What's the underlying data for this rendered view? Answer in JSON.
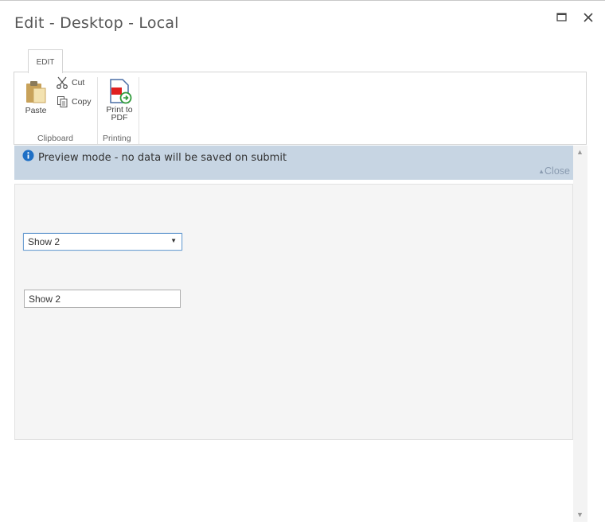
{
  "window": {
    "title": "Edit - Desktop - Local"
  },
  "ribbon": {
    "tab_label": "EDIT",
    "clipboard": {
      "group_label": "Clipboard",
      "paste_label": "Paste",
      "cut_label": "Cut",
      "copy_label": "Copy"
    },
    "printing": {
      "group_label": "Printing",
      "print_label_line1": "Print to",
      "print_label_line2": "PDF"
    }
  },
  "notice": {
    "message": "Preview mode - no data will be saved on submit",
    "close_label": "Close"
  },
  "form": {
    "dropdown_value": "Show 2",
    "text_value": "Show 2"
  },
  "colors": {
    "notice_bg": "#c7d5e3",
    "info_icon": "#1e6fc5",
    "form_bg": "#f5f5f5"
  }
}
